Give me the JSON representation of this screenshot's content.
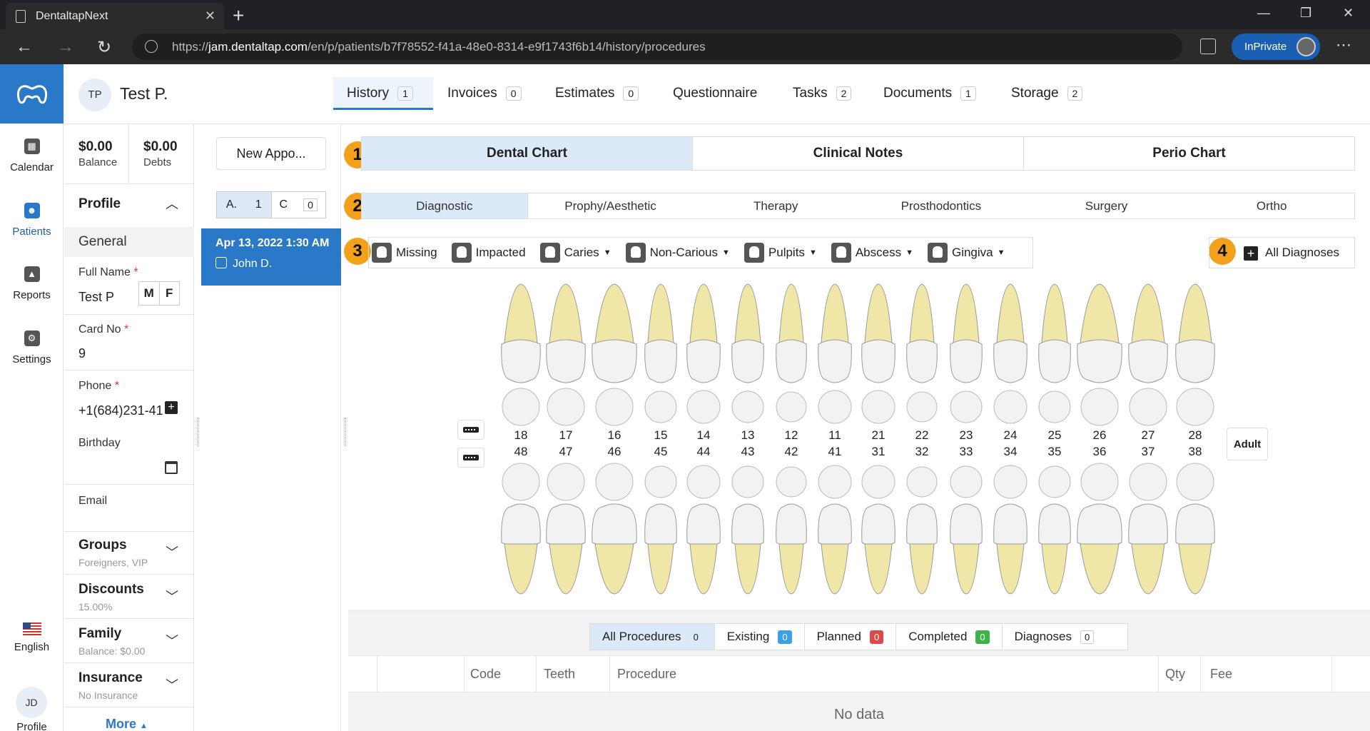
{
  "browser": {
    "tab_title": "DentaltapNext",
    "url_prefix": "https://",
    "url_host": "jam.dentaltap.com",
    "url_path": "/en/p/patients/b7f78552-f41a-48e0-8314-e9f1743f6b14/history/procedures",
    "inprivate_label": "InPrivate"
  },
  "leftnav": {
    "items": [
      {
        "label": "Calendar"
      },
      {
        "label": "Patients"
      },
      {
        "label": "Reports"
      },
      {
        "label": "Settings"
      }
    ],
    "language": "English",
    "user_initials": "JD",
    "user_label": "Profile"
  },
  "patient": {
    "initials": "TP",
    "name": "Test P."
  },
  "tabs": [
    {
      "label": "History",
      "count": "1"
    },
    {
      "label": "Invoices",
      "count": "0"
    },
    {
      "label": "Estimates",
      "count": "0"
    },
    {
      "label": "Questionnaire",
      "count": ""
    },
    {
      "label": "Tasks",
      "count": "2"
    },
    {
      "label": "Documents",
      "count": "1"
    },
    {
      "label": "Storage",
      "count": "2"
    }
  ],
  "profile": {
    "balance_value": "$0.00",
    "balance_label": "Balance",
    "debts_value": "$0.00",
    "debts_label": "Debts",
    "section_title": "Profile",
    "general_label": "General",
    "full_name_label": "Full Name",
    "full_name_value": "Test P",
    "gender_m": "M",
    "gender_f": "F",
    "card_no_label": "Card No",
    "card_no_value": "9",
    "phone_label": "Phone",
    "phone_value": "+1(684)231-41",
    "birthday_label": "Birthday",
    "email_label": "Email",
    "required_mark": "*",
    "groups_title": "Groups",
    "groups_sub": "Foreigners, VIP",
    "discounts_title": "Discounts",
    "discounts_sub": "15.00%",
    "family_title": "Family",
    "family_sub": "Balance: $0.00",
    "insurance_title": "Insurance",
    "insurance_sub": "No Insurance",
    "more_label": "More"
  },
  "appointments": {
    "new_button": "New Appo...",
    "a_label": "A.",
    "a_count": "1",
    "c_label": "C",
    "c_count": "0",
    "item_date": "Apr 13, 2022 1:30 AM",
    "item_doctor": "John D."
  },
  "badges": [
    "1",
    "2",
    "3",
    "4"
  ],
  "chart_tabs": [
    "Dental Chart",
    "Clinical Notes",
    "Perio Chart"
  ],
  "sub_tabs": [
    "Diagnostic",
    "Prophy/Aesthetic",
    "Therapy",
    "Prosthodontics",
    "Surgery",
    "Ortho"
  ],
  "tools": [
    {
      "label": "Missing",
      "dropdown": false
    },
    {
      "label": "Impacted",
      "dropdown": false
    },
    {
      "label": "Caries",
      "dropdown": true
    },
    {
      "label": "Non-Carious",
      "dropdown": true
    },
    {
      "label": "Pulpits",
      "dropdown": true
    },
    {
      "label": "Abscess",
      "dropdown": true
    },
    {
      "label": "Gingiva",
      "dropdown": true
    }
  ],
  "all_diagnoses_label": "All Diagnoses",
  "teeth_upper": [
    "18",
    "17",
    "16",
    "15",
    "14",
    "13",
    "12",
    "11",
    "21",
    "22",
    "23",
    "24",
    "25",
    "26",
    "27",
    "28"
  ],
  "teeth_lower": [
    "48",
    "47",
    "46",
    "45",
    "44",
    "43",
    "42",
    "41",
    "31",
    "32",
    "33",
    "34",
    "35",
    "36",
    "37",
    "38"
  ],
  "adult_label": "Adult",
  "filters": [
    {
      "label": "All Procedures",
      "count": "0",
      "color": ""
    },
    {
      "label": "Existing",
      "count": "0",
      "color": "#3ba0e8"
    },
    {
      "label": "Planned",
      "count": "0",
      "color": "#e04848"
    },
    {
      "label": "Completed",
      "count": "0",
      "color": "#3bb34a"
    },
    {
      "label": "Diagnoses",
      "count": "0",
      "color": ""
    }
  ],
  "table": {
    "columns": [
      "Code",
      "Teeth",
      "Procedure",
      "Qty",
      "Fee"
    ],
    "empty_text": "No data"
  },
  "colors": {
    "accent": "#2a78c8",
    "tooth_root": "#efe6a8",
    "tooth_crown": "#f2f2f2",
    "badge": "#f3a11a"
  }
}
